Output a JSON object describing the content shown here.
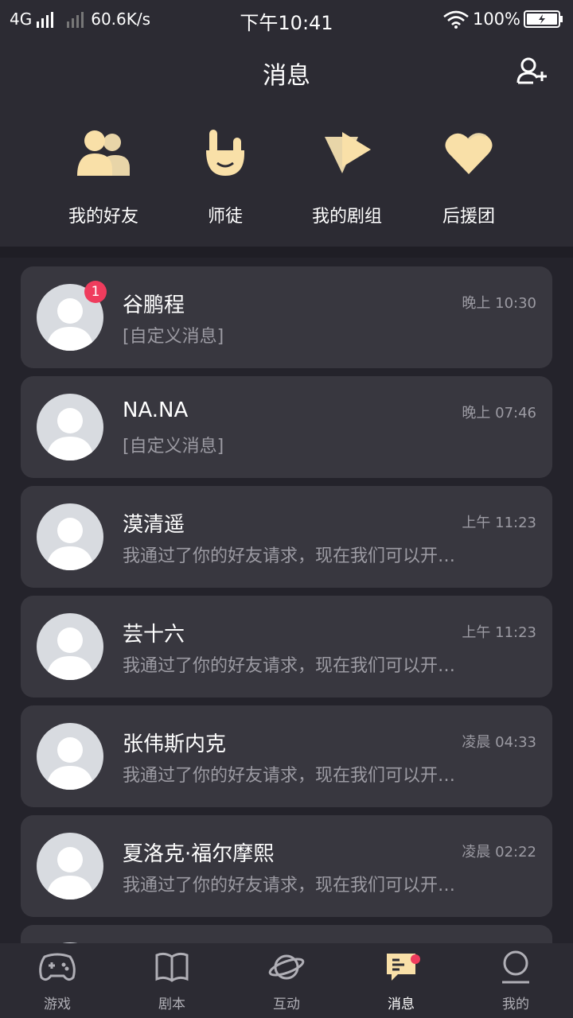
{
  "status_bar": {
    "network": "4G",
    "speed": "60.6K/s",
    "time": "下午10:41",
    "battery": "100%"
  },
  "header": {
    "title": "消息",
    "add_friend_icon": "add-user-icon"
  },
  "shortcuts": [
    {
      "label": "我的好友",
      "icon": "friends-icon"
    },
    {
      "label": "师徒",
      "icon": "hand-gesture-icon"
    },
    {
      "label": "我的剧组",
      "icon": "play-triangle-icon"
    },
    {
      "label": "后援团",
      "icon": "heart-icon"
    }
  ],
  "conversations": [
    {
      "name": "谷鹏程",
      "preview": "[自定义消息]",
      "time": "晚上 10:30",
      "badge": "1"
    },
    {
      "name": "NA.NA",
      "preview": "[自定义消息]",
      "time": "晚上 07:46"
    },
    {
      "name": "漠清遥",
      "preview": "我通过了你的好友请求，现在我们可以开…",
      "time": "上午 11:23"
    },
    {
      "name": "芸十六",
      "preview": "我通过了你的好友请求，现在我们可以开…",
      "time": "上午 11:23"
    },
    {
      "name": "张伟斯内克",
      "preview": "我通过了你的好友请求，现在我们可以开…",
      "time": "凌晨 04:33"
    },
    {
      "name": "夏洛克·福尔摩熙",
      "preview": "我通过了你的好友请求，现在我们可以开…",
      "time": "凌晨 02:22"
    }
  ],
  "tabs": [
    {
      "label": "游戏",
      "icon": "gamepad-icon"
    },
    {
      "label": "剧本",
      "icon": "book-icon"
    },
    {
      "label": "互动",
      "icon": "planet-icon"
    },
    {
      "label": "消息",
      "icon": "message-icon",
      "active": true
    },
    {
      "label": "我的",
      "icon": "profile-icon"
    }
  ],
  "colors": {
    "background": "#1f1e25",
    "card": "#38373f",
    "accent": "#f9e0a8",
    "badge": "#ef3c5d"
  }
}
